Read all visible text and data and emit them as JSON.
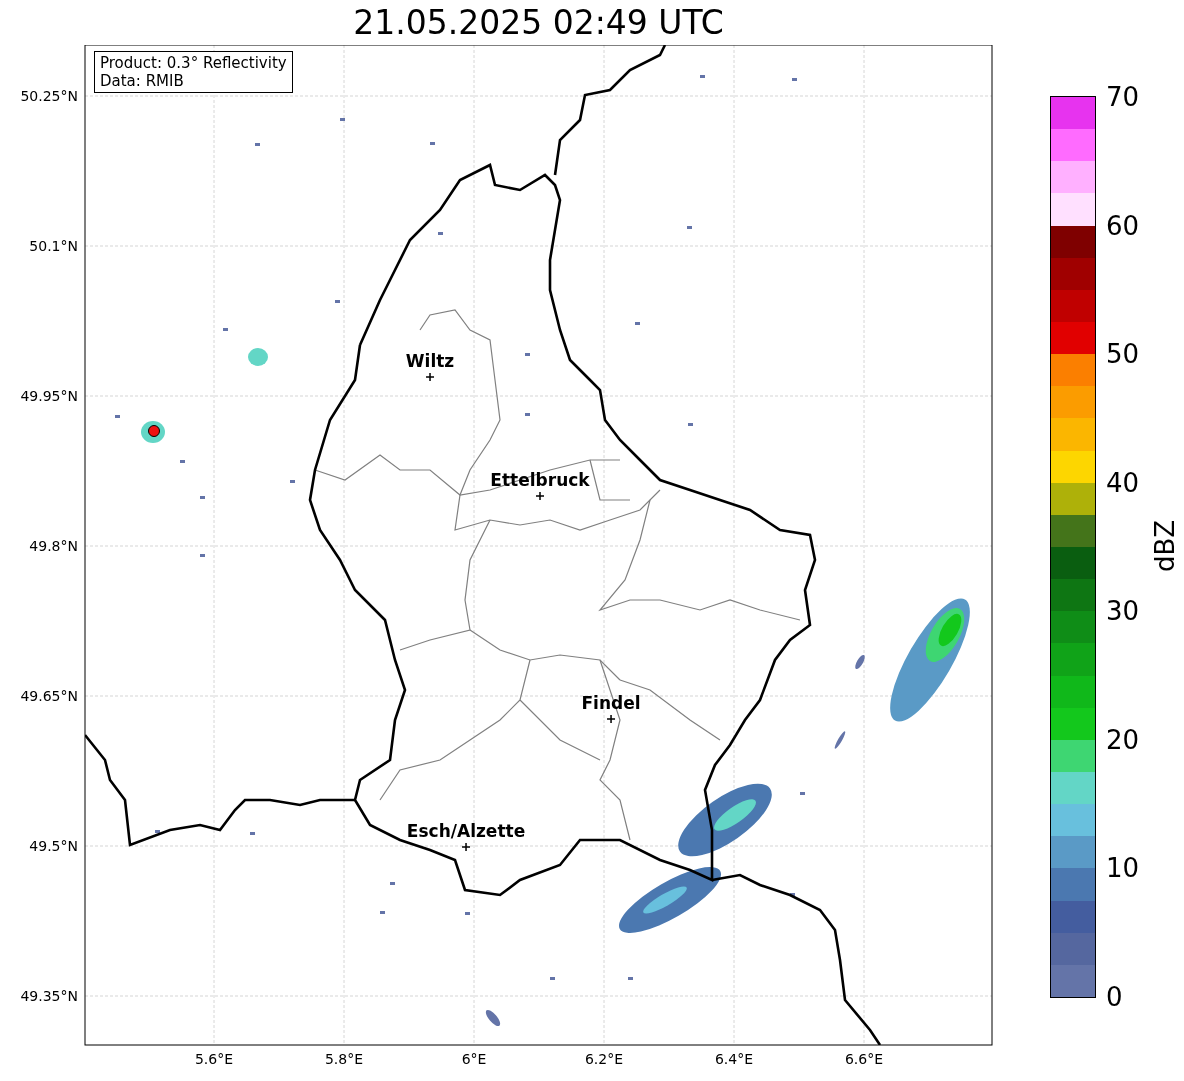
{
  "title": "21.05.2025 02:49 UTC",
  "info_box": {
    "product": "Product: 0.3° Reflectivity",
    "data": "Data: RMIB"
  },
  "map": {
    "xticks": [
      "5.6°E",
      "5.8°E",
      "6°E",
      "6.2°E",
      "6.4°E",
      "6.6°E"
    ],
    "yticks": [
      "50.25°N",
      "50.1°N",
      "49.95°N",
      "49.8°N",
      "49.65°N",
      "49.5°N",
      "49.35°N"
    ],
    "cities": [
      {
        "name": "Wiltz"
      },
      {
        "name": "Ettelbruck"
      },
      {
        "name": "Findel"
      },
      {
        "name": "Esch/Alzette"
      }
    ]
  },
  "colorbar": {
    "label": "dBZ",
    "ticks": [
      "70",
      "60",
      "50",
      "40",
      "30",
      "20",
      "10",
      "0"
    ],
    "segments": [
      {
        "color": "#e733ef"
      },
      {
        "color": "#ff6bff"
      },
      {
        "color": "#ffb0ff"
      },
      {
        "color": "#ffe0ff"
      },
      {
        "color": "#7f0000"
      },
      {
        "color": "#a00000"
      },
      {
        "color": "#c00000"
      },
      {
        "color": "#e10000"
      },
      {
        "color": "#fb7f00"
      },
      {
        "color": "#fb9c00"
      },
      {
        "color": "#fbb600"
      },
      {
        "color": "#fdd600"
      },
      {
        "color": "#aeb109"
      },
      {
        "color": "#44741a"
      },
      {
        "color": "#0a5e10"
      },
      {
        "color": "#0e7613"
      },
      {
        "color": "#0f8d17"
      },
      {
        "color": "#10a318"
      },
      {
        "color": "#10b81a"
      },
      {
        "color": "#13c81c"
      },
      {
        "color": "#3ed672"
      },
      {
        "color": "#63d6c6"
      },
      {
        "color": "#68c0dd"
      },
      {
        "color": "#5a9ac6"
      },
      {
        "color": "#4b78b0"
      },
      {
        "color": "#445d9f"
      },
      {
        "color": "#55679f"
      },
      {
        "color": "#6474a8"
      }
    ]
  }
}
